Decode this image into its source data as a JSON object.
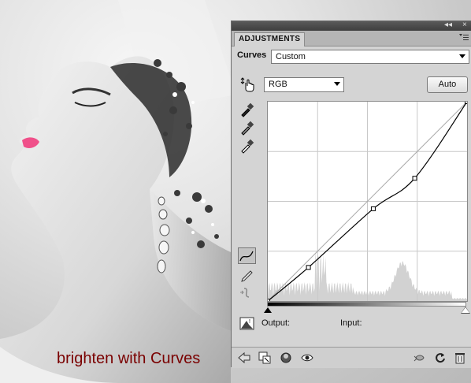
{
  "caption": "brighten with Curves",
  "panel": {
    "tab_label": "ADJUSTMENTS",
    "title_controls": {
      "collapse": "◂◂",
      "close": "×"
    },
    "menu_icon": "panel-menu-icon",
    "curves_label": "Curves",
    "preset_value": "Custom",
    "channel_value": "RGB",
    "auto_label": "Auto",
    "output_label": "Output:",
    "input_label": "Input:"
  },
  "curve": {
    "points": [
      [
        0,
        0
      ],
      [
        52,
        43
      ],
      [
        135,
        118
      ],
      [
        188,
        157
      ],
      [
        255,
        255
      ]
    ],
    "accent_color": "#000000",
    "grid_color": "#c8c8c8",
    "histogram_color": "#d2d2d2"
  },
  "icons": {
    "left": [
      "target-adjust-icon",
      "eyedropper-black-icon",
      "eyedropper-gray-icon",
      "eyedropper-white-icon",
      "curve-point-tool-icon",
      "pencil-tool-icon",
      "smooth-curve-icon",
      "clipping-warning-icon"
    ],
    "bottom": [
      "back-arrow-icon",
      "expanded-view-icon",
      "clip-layer-icon",
      "visibility-eye-icon",
      "view-previous-icon",
      "reset-icon",
      "delete-icon"
    ]
  }
}
